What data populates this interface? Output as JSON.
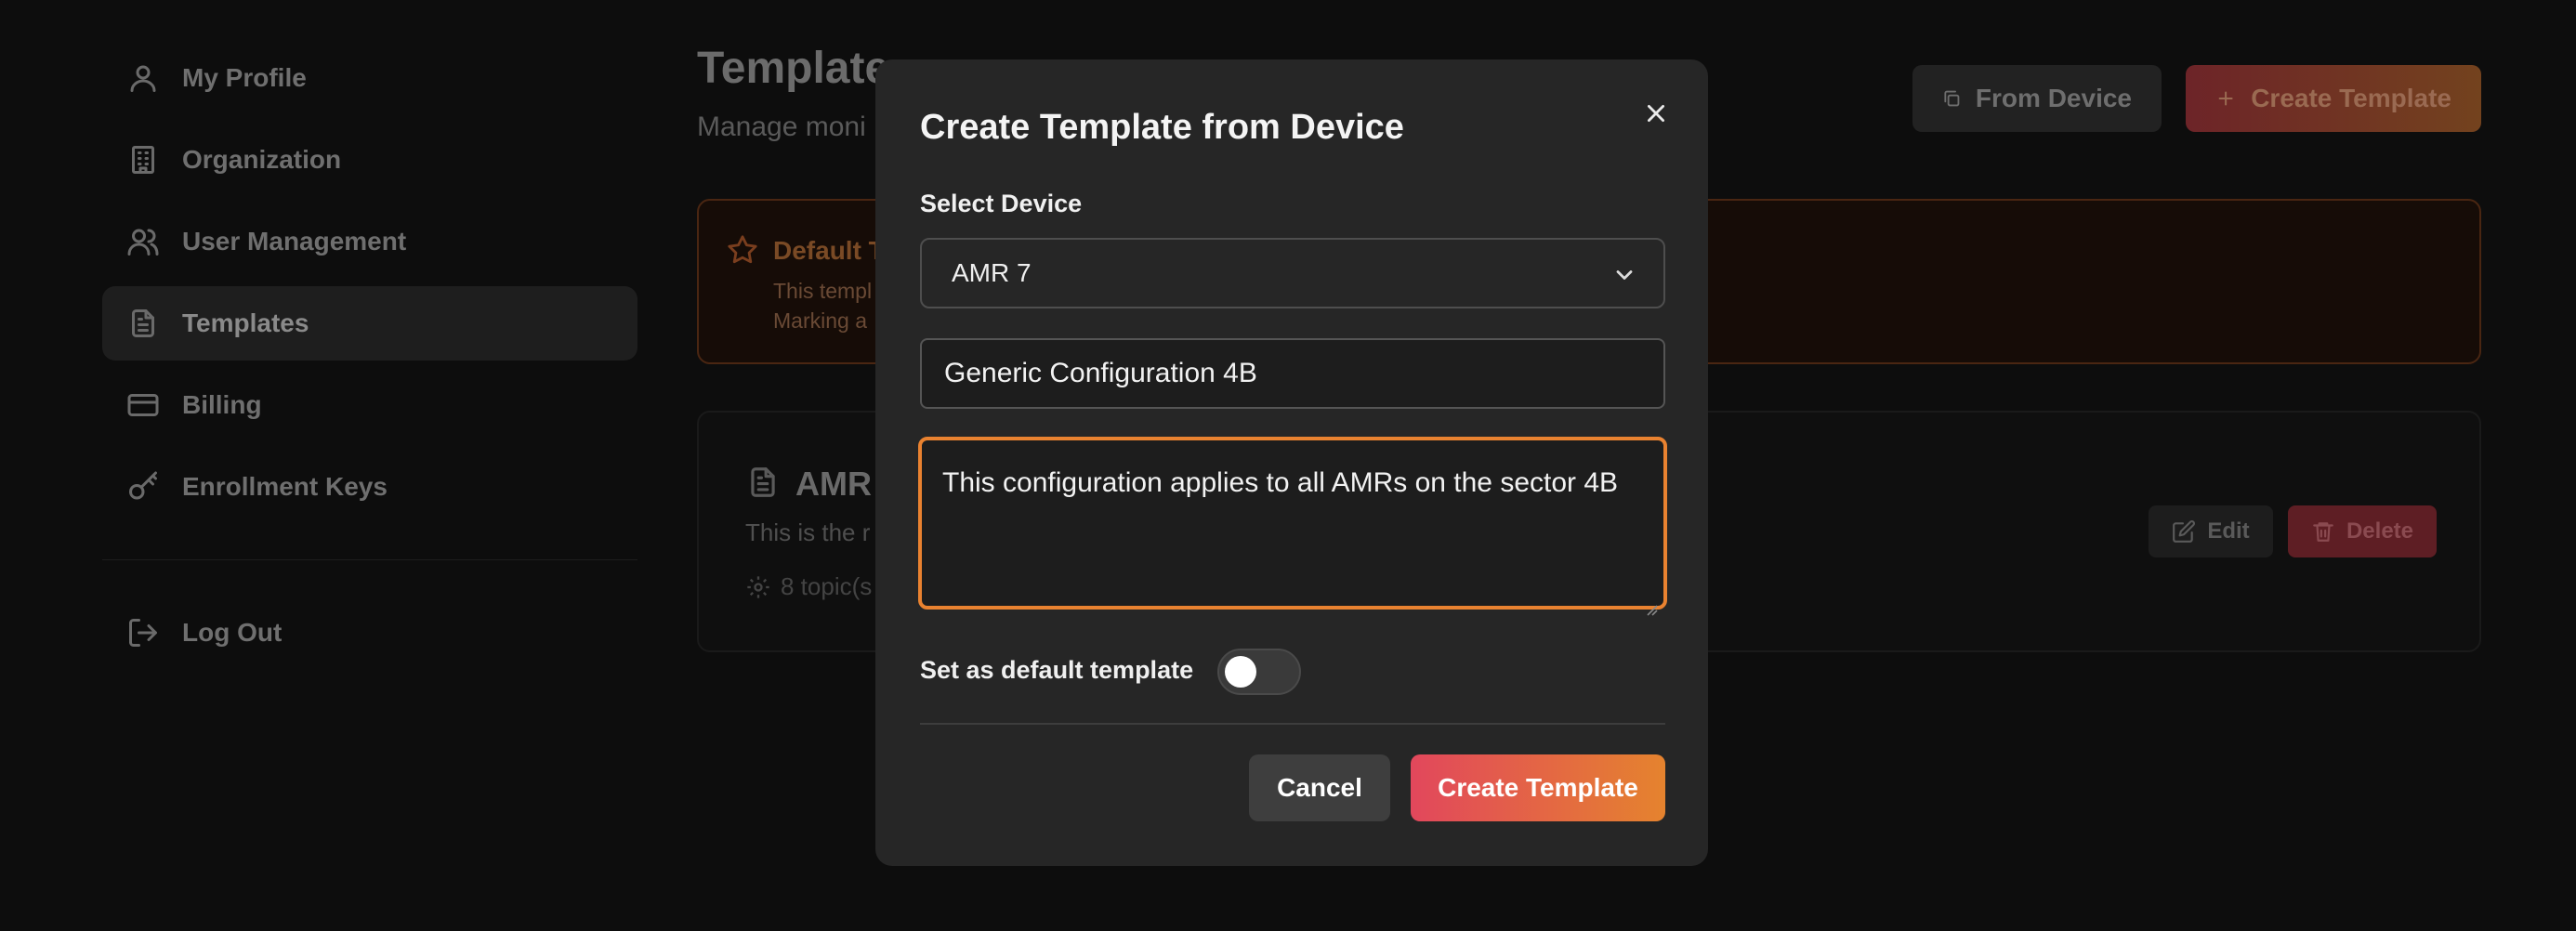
{
  "sidebar": {
    "items": [
      {
        "label": "My Profile",
        "icon": "user-icon"
      },
      {
        "label": "Organization",
        "icon": "building-icon"
      },
      {
        "label": "User Management",
        "icon": "users-icon"
      },
      {
        "label": "Templates",
        "icon": "file-text-icon",
        "active": true
      },
      {
        "label": "Billing",
        "icon": "credit-card-icon"
      },
      {
        "label": "Enrollment Keys",
        "icon": "key-icon"
      }
    ],
    "logout_label": "Log Out"
  },
  "header": {
    "title": "Template",
    "subtitle": "Manage moni",
    "from_device_label": "From Device",
    "create_template_label": "Create Template"
  },
  "alert": {
    "title": "Default T",
    "line1": "This templ",
    "line2": "Marking a"
  },
  "template_card": {
    "title": "AMR",
    "description": "This is the r",
    "meta": "8 topic(s",
    "edit_label": "Edit",
    "delete_label": "Delete"
  },
  "modal": {
    "title": "Create Template from Device",
    "select_device_label": "Select Device",
    "selected_device": "AMR 7",
    "name_value": "Generic Configuration 4B",
    "description_value": "This configuration applies to all AMRs on the sector 4B",
    "default_toggle_label": "Set as default template",
    "default_toggle_on": false,
    "cancel_label": "Cancel",
    "create_label": "Create Template"
  },
  "colors": {
    "accent_start": "#e2475c",
    "accent_end": "#e5832e",
    "focus_border": "#e98230"
  }
}
